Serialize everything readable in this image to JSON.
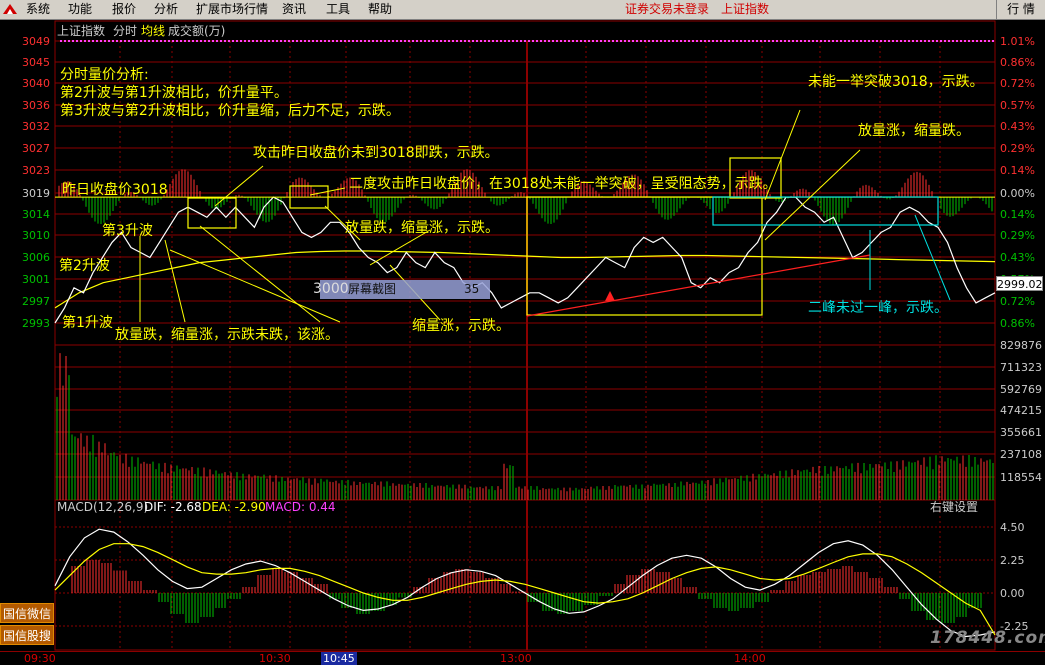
{
  "menu": {
    "items": [
      "系统",
      "功能",
      "报价",
      "分析",
      "扩展市场行情",
      "资讯",
      "工具",
      "帮助"
    ],
    "status_login": "证券交易未登录",
    "status_index": "上证指数",
    "right_button": "行 情"
  },
  "chart_header": {
    "name": "上证指数",
    "mode": "分时",
    "avg": "均线",
    "volume": "成交额(万)"
  },
  "price_axis": {
    "left_labels": [
      "3049",
      "3045",
      "3040",
      "3036",
      "3032",
      "3027",
      "3023",
      "3019",
      "3014",
      "3010",
      "3006",
      "3001",
      "2997",
      "2993"
    ],
    "right_labels": [
      "1.01%",
      "0.86%",
      "0.72%",
      "0.57%",
      "0.43%",
      "0.29%",
      "0.14%",
      "0.00%",
      "0.14%",
      "0.29%",
      "0.43%",
      "0.57%",
      "0.72%",
      "0.86%"
    ],
    "current_price": "2999.02"
  },
  "volume_axis": {
    "labels": [
      "829876",
      "711323",
      "592769",
      "474215",
      "355661",
      "237108",
      "118554"
    ]
  },
  "macd": {
    "params": "MACD(12,26,9)",
    "dif": "DIF: -2.68",
    "dea": "DEA: -2.90",
    "macd": "MACD: 0.44",
    "settings": "右键设置",
    "labels": [
      "4.50",
      "2.25",
      "0.00",
      "-2.25"
    ]
  },
  "annotations": {
    "analysis_title": "分时量价分析:",
    "analysis_line1": "第2升波与第1升波相比，价升量平。",
    "analysis_line2": "第3升波与第2升波相比，价升量缩，后力不足，示跌。",
    "prev_close": "昨日收盘价3018",
    "wave3": "第3升波",
    "wave2": "第2升波",
    "wave1": "第1升波",
    "attack1": "攻击昨日收盘价未到3018即跌，示跌。",
    "attack2": "二度攻击昨日收盘价，在3018处未能一举突破，呈受阻态势，示跌。",
    "vol_pattern1": "放量跌，缩量涨，示跌。",
    "vol_pattern2": "放量跌，缩量涨，示跌未跌，该涨。",
    "shrink_down": "缩量涨，示跌。",
    "break_fail": "未能一举突破3018，示跌。",
    "vol_up_down": "放量涨，缩量跌。",
    "two_peaks": "二峰未过一峰，示跌。"
  },
  "cursor": {
    "label": "屏幕截图",
    "value": "35",
    "price": "3000"
  },
  "time_axis": {
    "labels": [
      "09:30",
      "10:30",
      "10:45",
      "13:00",
      "14:00"
    ]
  },
  "side_buttons": [
    "国信微信",
    "国信股搜"
  ],
  "watermark": "178448.com",
  "colors": {
    "up": "#ff3030",
    "down": "#00c000",
    "grid": "#8b0000",
    "text_yellow": "#ffff00",
    "cyan": "#00e0e0",
    "magenta": "#ff40ff"
  },
  "chart_data": {
    "type": "line",
    "title": "上证指数 分时",
    "prev_close": 3018,
    "ylim": [
      2993,
      3049
    ],
    "price": [
      2993,
      2996,
      3000,
      2999,
      3003,
      3006,
      3009,
      3011,
      3008,
      3007,
      3006,
      3009,
      3012,
      3015,
      3016,
      3015,
      3014,
      3016,
      3014,
      3016,
      3014,
      3012,
      3016,
      3018,
      3017,
      3014,
      3011,
      3010,
      3011,
      3013,
      3013,
      3011,
      3008,
      3006,
      3005,
      3003,
      3004,
      3007,
      3005,
      3004,
      3007,
      3005,
      3004,
      3001,
      3000,
      3001,
      2999,
      2996,
      2997,
      2998,
      2999,
      2999,
      2998,
      2997,
      2998,
      3000,
      3002,
      3004,
      3006,
      3005,
      3004,
      3008,
      3010,
      3009,
      3010,
      3008,
      3006,
      3001,
      3000,
      3002,
      3001,
      3003,
      3004,
      3007,
      3009,
      3013,
      3015,
      3018,
      3018,
      3016,
      3015,
      3013,
      3014,
      3010,
      3006,
      3007,
      3009,
      3011,
      3012,
      3015,
      3016,
      3015,
      3013,
      3012,
      3009,
      3004,
      3000,
      2997,
      2998,
      2999
    ],
    "avg": [
      2996,
      2999,
      3001,
      3002,
      3003,
      3004,
      3005,
      3005.5,
      3006,
      3006.5,
      3007,
      3007.2,
      3007.3,
      3007.3,
      3007.2,
      3007.1,
      3007,
      3006.8,
      3006.6,
      3006.4,
      3006.2,
      3006,
      3006,
      3006.1,
      3006.2,
      3006.3,
      3006.4,
      3006.4,
      3006.3,
      3006.2,
      3006.1,
      3006,
      3005.9,
      3005.8,
      3005.7,
      3005.6,
      3005.5,
      3005.4,
      3005.3,
      3005.2
    ],
    "volume": [
      0.95,
      0.45,
      0.42,
      0.38,
      0.33,
      0.3,
      0.28,
      0.26,
      0.24,
      0.23,
      0.22,
      0.21,
      0.2,
      0.19,
      0.18,
      0.17,
      0.17,
      0.16,
      0.15,
      0.15,
      0.14,
      0.14,
      0.13,
      0.13,
      0.12,
      0.12,
      0.12,
      0.11,
      0.11,
      0.11,
      0.1,
      0.1,
      0.1,
      0.09,
      0.09,
      0.09,
      0.24,
      0.09,
      0.09,
      0.08,
      0.08,
      0.08,
      0.08,
      0.09,
      0.09,
      0.1,
      0.1,
      0.1,
      0.11,
      0.11,
      0.12,
      0.12,
      0.13,
      0.14,
      0.15,
      0.16,
      0.17,
      0.18,
      0.19,
      0.2,
      0.21,
      0.22,
      0.22,
      0.23,
      0.24,
      0.24,
      0.25,
      0.25,
      0.26,
      0.27,
      0.28,
      0.29,
      0.29,
      0.29,
      0.28,
      0.28
    ],
    "macd_hist": [
      0,
      1.8,
      2.2,
      2.0,
      1.5,
      0.8,
      0.2,
      -0.6,
      -1.4,
      -2.0,
      -1.6,
      -1.0,
      -0.4,
      0.4,
      1.2,
      1.6,
      1.4,
      1.0,
      0.6,
      -0.4,
      -1.0,
      -1.4,
      -1.2,
      -0.8,
      -0.3,
      0.4,
      1.0,
      1.4,
      1.6,
      1.4,
      1.0,
      0.6,
      0.1,
      -0.6,
      -1.2,
      -1.4,
      -1.2,
      -0.8,
      -0.2,
      0.6,
      1.2,
      1.6,
      1.4,
      1.0,
      0.4,
      -0.4,
      -1.0,
      -1.2,
      -1.0,
      -0.6,
      0.2,
      0.8,
      1.2,
      1.4,
      1.6,
      1.8,
      1.4,
      1.0,
      0.4,
      -0.4,
      -1.2,
      -1.8,
      -2.0,
      -1.6,
      -1.0,
      0.0
    ],
    "dif": [
      0.5,
      2.5,
      3.8,
      4.4,
      4.2,
      3.5,
      2.6,
      1.6,
      0.8,
      0.3,
      0.4,
      1.0,
      1.6,
      2.0,
      2.2,
      1.9,
      1.4,
      0.8,
      0.2,
      -0.4,
      -0.9,
      -1.2,
      -1.1,
      -0.8,
      -0.3,
      0.4,
      1.0,
      1.4,
      1.6,
      1.5,
      1.2,
      0.6,
      0.0,
      -0.6,
      -1.1,
      -1.4,
      -1.3,
      -0.9,
      -0.4,
      0.4,
      1.2,
      1.9,
      2.4,
      2.6,
      2.4,
      1.8,
      1.0,
      0.4,
      0.2,
      0.6,
      1.2,
      2.0,
      2.8,
      3.4,
      3.6,
      3.3,
      2.6,
      1.6,
      0.4,
      -0.8,
      -1.8,
      -2.6,
      -3.0,
      -2.9,
      -2.68
    ],
    "dea": [
      0.2,
      1.2,
      2.2,
      3.0,
      3.4,
      3.4,
      3.2,
      2.8,
      2.3,
      1.8,
      1.4,
      1.3,
      1.3,
      1.4,
      1.6,
      1.7,
      1.7,
      1.5,
      1.2,
      0.8,
      0.4,
      0.0,
      -0.3,
      -0.5,
      -0.5,
      -0.3,
      0.0,
      0.3,
      0.6,
      0.8,
      0.9,
      0.8,
      0.6,
      0.3,
      0.0,
      -0.3,
      -0.6,
      -0.7,
      -0.6,
      -0.4,
      0.0,
      0.5,
      1.0,
      1.4,
      1.7,
      1.8,
      1.6,
      1.3,
      1.0,
      0.9,
      1.0,
      1.3,
      1.7,
      2.1,
      2.5,
      2.7,
      2.7,
      2.5,
      2.0,
      1.4,
      0.7,
      0.0,
      -0.7,
      -1.2,
      -2.9
    ]
  }
}
